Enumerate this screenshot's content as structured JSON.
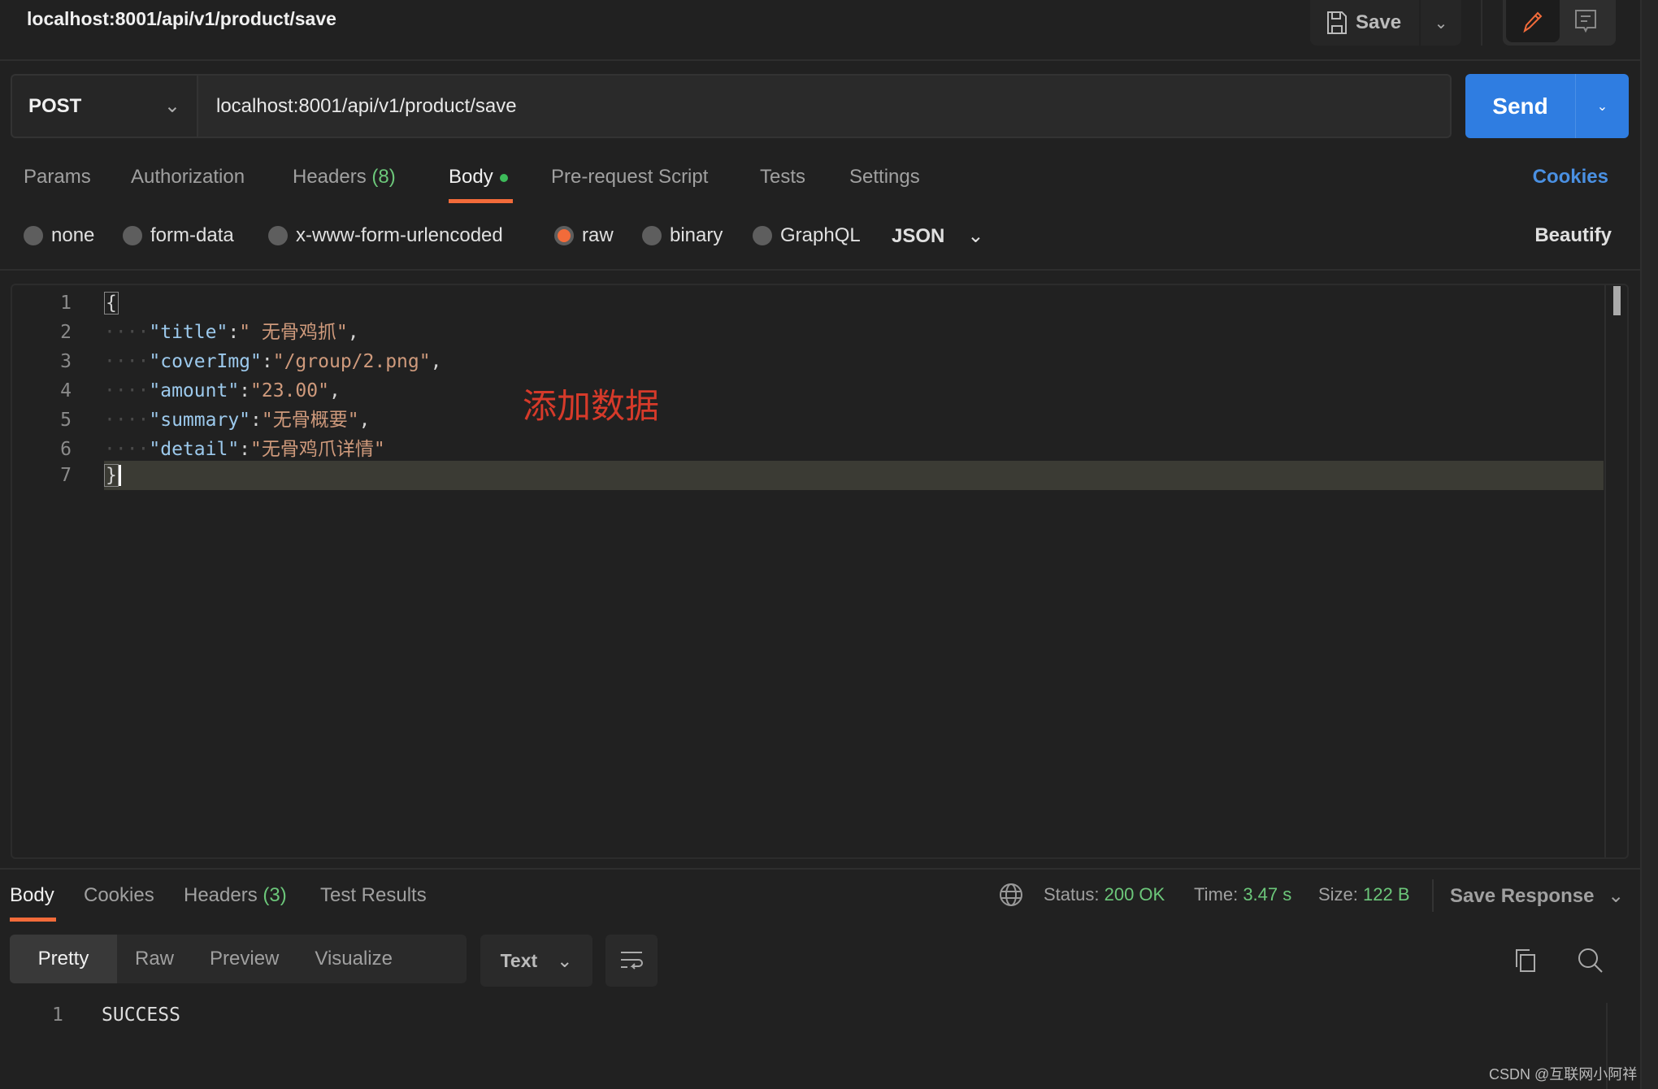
{
  "header": {
    "title": "localhost:8001/api/v1/product/save",
    "save_label": "Save"
  },
  "request": {
    "method": "POST",
    "url": "localhost:8001/api/v1/product/save",
    "send_label": "Send"
  },
  "tabs": [
    {
      "label": "Params"
    },
    {
      "label": "Authorization"
    },
    {
      "label": "Headers",
      "count": "(8)"
    },
    {
      "label": "Body"
    },
    {
      "label": "Pre-request Script"
    },
    {
      "label": "Tests"
    },
    {
      "label": "Settings"
    }
  ],
  "cookies_label": "Cookies",
  "body_types": [
    {
      "label": "none"
    },
    {
      "label": "form-data"
    },
    {
      "label": "x-www-form-urlencoded"
    },
    {
      "label": "raw",
      "selected": true
    },
    {
      "label": "binary"
    },
    {
      "label": "GraphQL"
    }
  ],
  "format": "JSON",
  "beautify_label": "Beautify",
  "editor": {
    "line_numbers": [
      "1",
      "2",
      "3",
      "4",
      "5",
      "6",
      "7"
    ],
    "lines": [
      {
        "key": "\"title\"",
        "value": "\" 无骨鸡抓\"",
        "end": ","
      },
      {
        "key": "\"coverImg\"",
        "value": "\"/group/2.png\"",
        "end": ","
      },
      {
        "key": "\"amount\"",
        "value": "\"23.00\"",
        "end": ","
      },
      {
        "key": "\"summary\"",
        "value": "\"无骨概要\"",
        "end": ","
      },
      {
        "key": "\"detail\"",
        "value": "\"无骨鸡爪详情\"",
        "end": ""
      }
    ],
    "open": "{",
    "close": "}"
  },
  "annotation": "添加数据",
  "response": {
    "tabs": [
      {
        "label": "Body"
      },
      {
        "label": "Cookies"
      },
      {
        "label": "Headers",
        "count": "(3)"
      },
      {
        "label": "Test Results"
      }
    ],
    "status_label": "Status:",
    "status": "200 OK",
    "time_label": "Time:",
    "time": "3.47 s",
    "size_label": "Size:",
    "size": "122 B",
    "save_response": "Save Response",
    "views": [
      "Pretty",
      "Raw",
      "Preview",
      "Visualize"
    ],
    "text_format": "Text",
    "line_number": "1",
    "body": "SUCCESS"
  },
  "watermark": "CSDN @互联网小阿祥",
  "colors": {
    "accent": "#f26b3a",
    "send": "#2f7de1",
    "link": "#4a90e2",
    "success": "#6cc77a",
    "annotation": "#d63a2a"
  }
}
